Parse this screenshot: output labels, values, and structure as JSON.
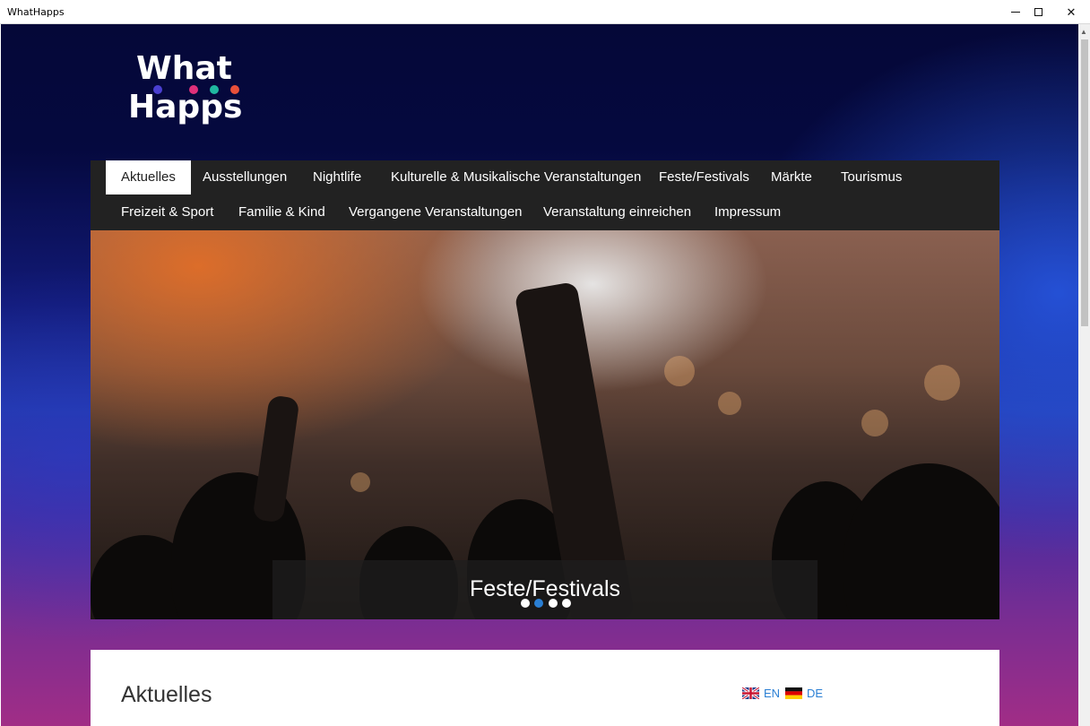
{
  "window": {
    "title": "WhatHapps",
    "minimize_glyph": "—",
    "maximize_glyph": "☐",
    "close_glyph": "✕"
  },
  "logo": {
    "line1": "What",
    "line2": "Happs",
    "dot_colors": [
      "#4a3fd0",
      "#e0307a",
      "#20b8a0",
      "#e8503a"
    ]
  },
  "nav": {
    "items": [
      {
        "label": "Aktuelles",
        "active": true
      },
      {
        "label": "Ausstellungen"
      },
      {
        "label": "Nightlife"
      },
      {
        "label": "Kulturelle & Musikalische Veranstaltungen"
      },
      {
        "label": "Feste/Festivals"
      },
      {
        "label": "Märkte"
      },
      {
        "label": "Tourismus"
      },
      {
        "label": "Freizeit & Sport"
      },
      {
        "label": "Familie & Kind"
      },
      {
        "label": "Vergangene Veranstaltungen"
      },
      {
        "label": "Veranstaltung einreichen"
      },
      {
        "label": "Impressum"
      }
    ]
  },
  "hero": {
    "caption": "Feste/Festivals",
    "slide_count": 4,
    "active_slide": 2
  },
  "content": {
    "heading": "Aktuelles",
    "languages": [
      {
        "code": "EN",
        "flag": "uk-flag-icon"
      },
      {
        "code": "DE",
        "flag": "germany-flag-icon"
      }
    ]
  },
  "colors": {
    "link": "#2a7fd4",
    "nav_bg": "#222222",
    "active_dot": "#2a7fd4"
  }
}
